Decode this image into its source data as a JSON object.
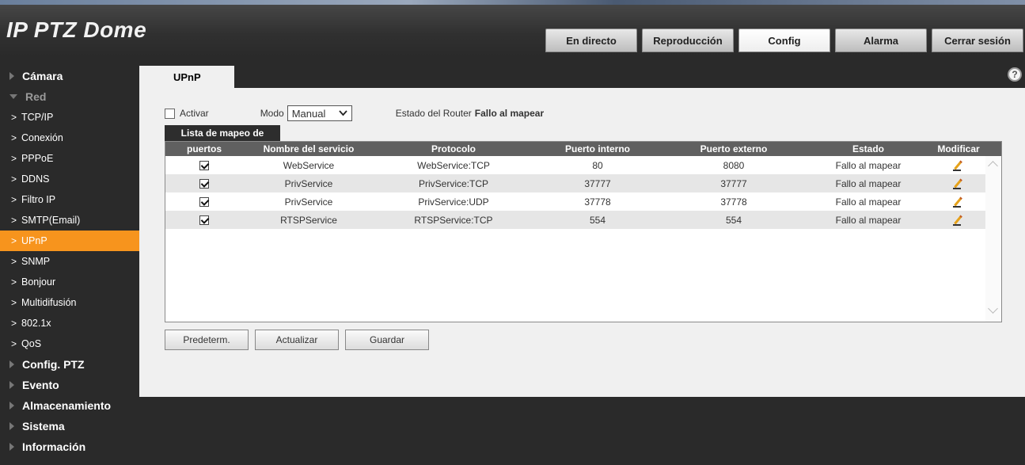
{
  "app": {
    "title": "IP PTZ Dome"
  },
  "topnav": [
    {
      "label": "En directo",
      "active": false
    },
    {
      "label": "Reproducción",
      "active": false
    },
    {
      "label": "Config",
      "active": true
    },
    {
      "label": "Alarma",
      "active": false
    },
    {
      "label": "Cerrar sesión",
      "active": false
    }
  ],
  "sidebar": {
    "groups": [
      {
        "label": "Cámara"
      },
      {
        "label": "Red"
      },
      {
        "label": "Config. PTZ"
      },
      {
        "label": "Evento"
      },
      {
        "label": "Almacenamiento"
      },
      {
        "label": "Sistema"
      },
      {
        "label": "Información"
      }
    ],
    "red_items": [
      {
        "label": "TCP/IP"
      },
      {
        "label": "Conexión"
      },
      {
        "label": "PPPoE"
      },
      {
        "label": "DDNS"
      },
      {
        "label": "Filtro IP"
      },
      {
        "label": "SMTP(Email)"
      },
      {
        "label": "UPnP",
        "active": true
      },
      {
        "label": "SNMP"
      },
      {
        "label": "Bonjour"
      },
      {
        "label": "Multidifusión"
      },
      {
        "label": "802.1x"
      },
      {
        "label": "QoS"
      }
    ],
    "active_color": "#f7941d"
  },
  "tab": {
    "label": "UPnP"
  },
  "options": {
    "enable_label": "Activar",
    "enable_checked": false,
    "mode_label": "Modo",
    "mode_value": "Manual",
    "router_label": "Estado del Router",
    "router_value": "Fallo al mapear"
  },
  "mapping": {
    "tab_label": "Lista de mapeo de",
    "columns": [
      "puertos",
      "Nombre del servicio",
      "Protocolo",
      "Puerto interno",
      "Puerto externo",
      "Estado",
      "Modificar"
    ],
    "rows": [
      {
        "checked": true,
        "name": "WebService",
        "protocol": "WebService:TCP",
        "internal": "80",
        "external": "8080",
        "status": "Fallo al mapear"
      },
      {
        "checked": true,
        "name": "PrivService",
        "protocol": "PrivService:TCP",
        "internal": "37777",
        "external": "37777",
        "status": "Fallo al mapear"
      },
      {
        "checked": true,
        "name": "PrivService",
        "protocol": "PrivService:UDP",
        "internal": "37778",
        "external": "37778",
        "status": "Fallo al mapear"
      },
      {
        "checked": true,
        "name": "RTSPService",
        "protocol": "RTSPService:TCP",
        "internal": "554",
        "external": "554",
        "status": "Fallo al mapear"
      }
    ]
  },
  "buttons": {
    "default": "Predeterm.",
    "refresh": "Actualizar",
    "save": "Guardar"
  }
}
